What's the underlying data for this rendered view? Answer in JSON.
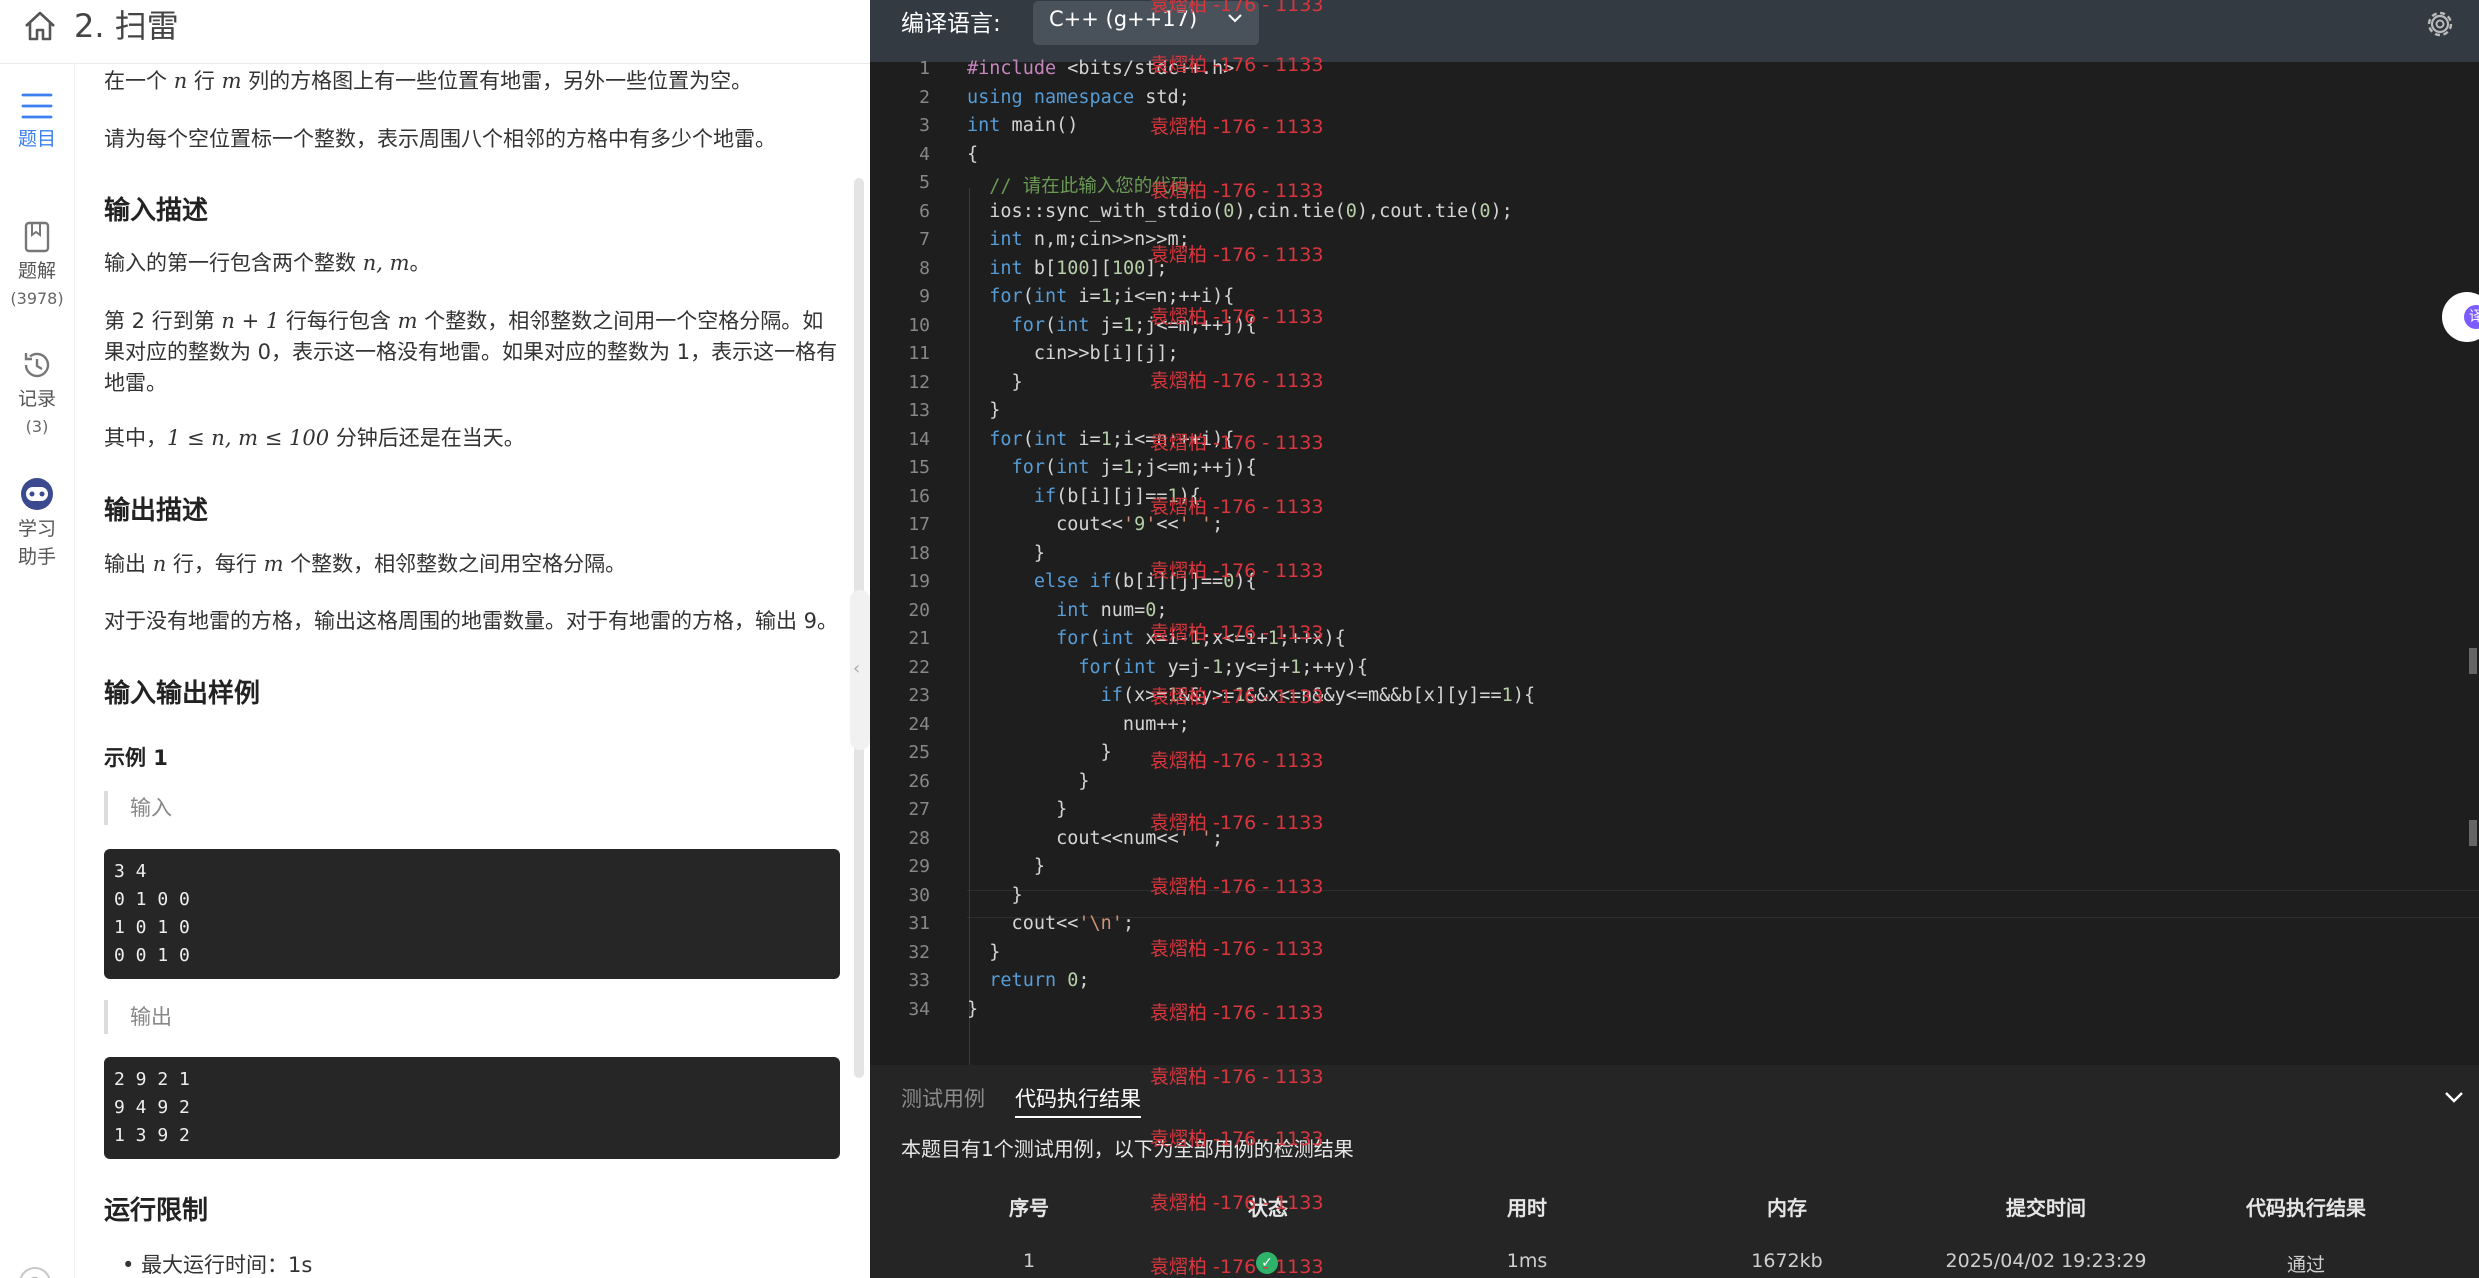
{
  "problem": {
    "title": "2. 扫雷",
    "intro": [
      "在一个 ",
      "n",
      " 行 ",
      "m",
      " 列的方格图上有一些位置有地雷，另外一些位置为空。"
    ],
    "intro2": "请为每个空位置标一个整数，表示周围八个相邻的方格中有多少个地雷。",
    "input_heading": "输入描述",
    "input_desc1": [
      "输入的第一行包含两个整数 ",
      "n, m",
      "。"
    ],
    "input_desc2": [
      "第 2 行到第 ",
      "n + 1",
      " 行每行包含 ",
      "m",
      " 个整数，相邻整数之间用一个空格分隔。如果对应的整数为 0，表示这一格没有地雷。如果对应的整数为 1，表示这一格有地雷。"
    ],
    "input_desc3": [
      "其中，",
      "1 ≤ n, m ≤ 100",
      " 分钟后还是在当天。"
    ],
    "output_heading": "输出描述",
    "output_desc1": [
      "输出 ",
      "n",
      " 行，每行 ",
      "m",
      " 个整数，相邻整数之间用空格分隔。"
    ],
    "output_desc2": "对于没有地雷的方格，输出这格周围的地雷数量。对于有地雷的方格，输出 9。",
    "samples_heading": "输入输出样例",
    "example_label": "示例 1",
    "input_label": "输入",
    "sample_input": [
      "3 4",
      "0 1 0 0",
      "1 0 1 0",
      "0 0 1 0"
    ],
    "output_label": "输出",
    "sample_output": [
      "2 9 2 1",
      "9 4 9 2",
      "1 3 9 2"
    ],
    "limits_heading": "运行限制",
    "limit_time": "最大运行时间：1s"
  },
  "sidebar": {
    "items": [
      {
        "label": "题目",
        "icon": "list-icon",
        "active": true
      },
      {
        "label": "题解",
        "count": "(3978)",
        "icon": "book-icon"
      },
      {
        "label": "记录",
        "count": "(3)",
        "icon": "history-icon"
      },
      {
        "label": "学习",
        "label2": "助手",
        "icon": "robot-icon"
      }
    ],
    "help": "?"
  },
  "editor": {
    "lang_label": "编译语言:",
    "lang_value": "C++ (g++17)",
    "watermark": "袁熠柏 -176 - 1133",
    "lines": [
      "#include <bits/stdc++.h>",
      "using namespace std;",
      "int main()",
      "{",
      "  // 请在此输入您的代码",
      "  ios::sync_with_stdio(0),cin.tie(0),cout.tie(0);",
      "  int n,m;cin>>n>>m;",
      "  int b[100][100];",
      "  for(int i=1;i<=n;++i){",
      "    for(int j=1;j<=m;++j){",
      "      cin>>b[i][j];",
      "    }",
      "  }",
      "  for(int i=1;i<=n;++i){",
      "    for(int j=1;j<=m;++j){",
      "      if(b[i][j]==1){",
      "        cout<<'9'<<' ';",
      "      }",
      "      else if(b[i][j]==0){",
      "        int num=0;",
      "        for(int x=i-1;x<=i+1;++x){",
      "          for(int y=j-1;y<=j+1;++y){",
      "            if(x>=1&&y>=1&&x<=n&&y<=m&&b[x][y]==1){",
      "              num++;",
      "            }",
      "          }",
      "        }",
      "        cout<<num<<' ';",
      "      }",
      "    }",
      "    cout<<'\\n';",
      "  }",
      "  return 0;",
      "}"
    ]
  },
  "results": {
    "tab_test": "测试用例",
    "tab_result": "代码执行结果",
    "summary": "本题目有1个测试用例，以下为全部用例的检测结果",
    "headers": [
      "序号",
      "状态",
      "用时",
      "内存",
      "提交时间",
      "代码执行结果"
    ],
    "row": [
      "1",
      "",
      "1ms",
      "1672kb",
      "2025/04/02 19:23:29",
      "通过"
    ]
  },
  "colors": {
    "accent": "#3b7ff0",
    "editor_bg": "#1e1e1e",
    "watermark": "#d9363e",
    "pass": "#2fb36b"
  }
}
